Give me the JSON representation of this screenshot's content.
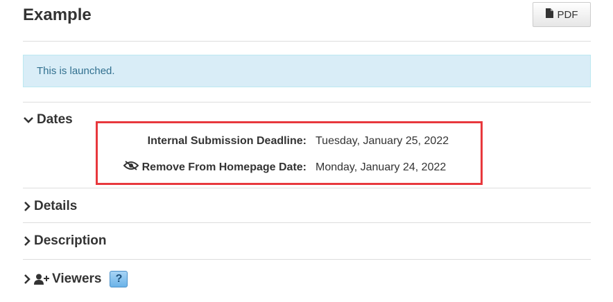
{
  "header": {
    "title": "Example",
    "pdf_label": "PDF"
  },
  "alert": {
    "text": "This is launched."
  },
  "sections": {
    "dates": {
      "label": "Dates",
      "rows": [
        {
          "label": "Internal Submission Deadline:",
          "value": "Tuesday, January 25, 2022"
        },
        {
          "label": "Remove From Homepage Date:",
          "value": "Monday, January 24, 2022"
        }
      ]
    },
    "details": {
      "label": "Details"
    },
    "description": {
      "label": "Description"
    },
    "viewers": {
      "label": "Viewers",
      "help": "?"
    }
  },
  "colors": {
    "alert_bg": "#d9edf7",
    "alert_text": "#31708f",
    "highlight_border": "#e8383d"
  }
}
